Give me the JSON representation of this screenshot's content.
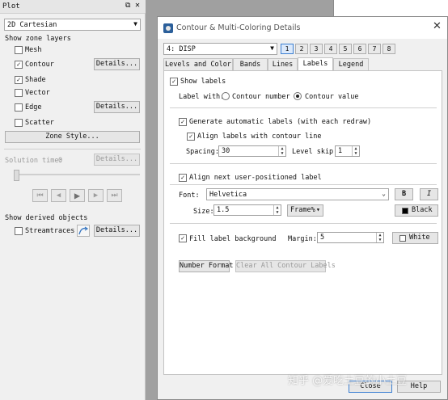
{
  "plot_panel": {
    "title": "Plot",
    "plot_type": "2D Cartesian",
    "zone_layers_heading": "Show zone layers",
    "layers": [
      {
        "label": "Mesh",
        "checked": false,
        "details": ""
      },
      {
        "label": "Contour",
        "checked": true,
        "details": "Details..."
      },
      {
        "label": "Shade",
        "checked": true,
        "details": ""
      },
      {
        "label": "Vector",
        "checked": false,
        "details": ""
      },
      {
        "label": "Edge",
        "checked": false,
        "details": "Details..."
      },
      {
        "label": "Scatter",
        "checked": false,
        "details": ""
      }
    ],
    "zone_style_button": "Zone Style...",
    "solution_time_label": "Solution time:",
    "solution_time_value": "0",
    "solution_details": "Details...",
    "derived_heading": "Show derived objects",
    "streamtraces_label": "Streamtraces",
    "streamtraces_details": "Details...",
    "check_mark": "✓"
  },
  "dialog": {
    "title": "Contour & Multi-Coloring Details",
    "close_glyph": "✕",
    "zone_selector": "4: DISP",
    "zone_buttons": [
      "1",
      "2",
      "3",
      "4",
      "5",
      "6",
      "7",
      "8"
    ],
    "tabs": [
      "Levels and Color",
      "Bands",
      "Lines",
      "Labels",
      "Legend"
    ],
    "active_tab": "Labels",
    "labels_tab": {
      "show_labels": "Show labels",
      "label_with": "Label with:",
      "contour_number": "Contour number",
      "contour_value": "Contour value",
      "generate_auto": "Generate automatic labels (with each redraw)",
      "align_labels": "Align labels with contour line",
      "spacing_label": "Spacing:",
      "spacing_value": "30",
      "level_skip_label": "Level skip:",
      "level_skip_value": "1",
      "align_next": "Align next user-positioned label",
      "font_label": "Font:",
      "font_value": "Helvetica",
      "bold_button": "B",
      "italic_button": "I",
      "size_label": "Size:",
      "size_value": "1.5",
      "size_units": "Frame%",
      "color_label": "Black",
      "fill_background": "Fill label background",
      "margin_label": "Margin:",
      "margin_value": "5",
      "fill_color_label": "White",
      "number_format_button": "Number Format",
      "clear_labels_button": "Clear All Contour Labels"
    },
    "close_button": "Close",
    "help_button": "Help"
  },
  "watermark": "知乎 @爱吃土豆的小土豆",
  "colors": {
    "black_swatch": "#000000",
    "white_swatch": "#ffffff",
    "accent": "#3c7fd2",
    "streamtrace_icon": "#3a78c2"
  }
}
